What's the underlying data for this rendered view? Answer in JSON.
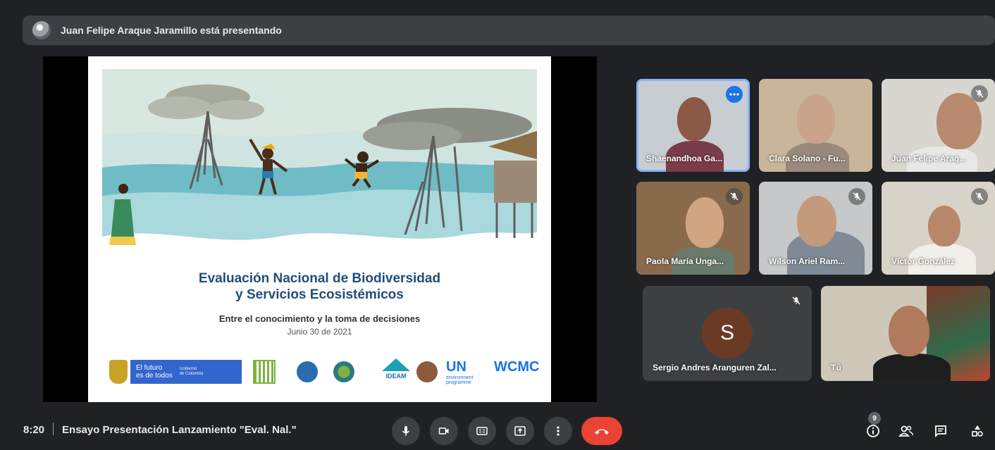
{
  "presenter_bar": {
    "text": "Juan Felipe Araque Jaramillo está presentando"
  },
  "slide": {
    "title_line1": "Evaluación Nacional de Biodiversidad",
    "title_line2": "y Servicios Ecosistémicos",
    "subtitle": "Entre el conocimiento y la toma de decisiones",
    "date": "Junio 30 de 2021",
    "logos": {
      "gov_main_line1": "El futuro",
      "gov_main_line2": "es de todos",
      "gov_small_line1": "Gobierno",
      "gov_small_line2": "de Colombia",
      "ideam": "IDEAM",
      "un": "UN",
      "un_sub_line1": "environment",
      "un_sub_line2": "programme",
      "wcmc": "WCMC"
    }
  },
  "participants": [
    {
      "name": "Shaenandhoa Ga...",
      "muted": false,
      "active_speaker": true
    },
    {
      "name": "Clara Solano - Fu...",
      "muted": false
    },
    {
      "name": "Juan Felipe Araq...",
      "muted": true
    },
    {
      "name": "Paola María Unga...",
      "muted": true
    },
    {
      "name": "Wilson Ariel Ram...",
      "muted": true
    },
    {
      "name": "Víctor González",
      "muted": true
    },
    {
      "name": "Sergio Andres Aranguren Zal...",
      "muted": true,
      "initial": "S"
    },
    {
      "name": "Tú",
      "muted": false
    }
  ],
  "bottom_bar": {
    "time": "8:20",
    "meeting_title": "Ensayo Presentación Lanzamiento \"Eval. Nal.\"",
    "people_count": "9"
  },
  "colors": {
    "background": "#202124",
    "bar": "#3c4043",
    "accent": "#1a73e8",
    "end_call": "#ea4335",
    "slide_title": "#1f4e79"
  },
  "icons": {
    "controls": [
      "mic-icon",
      "camera-icon",
      "captions-icon",
      "present-icon",
      "more-vert-icon",
      "end-call-icon"
    ],
    "right": [
      "info-icon",
      "people-icon",
      "chat-icon",
      "activities-icon"
    ]
  }
}
